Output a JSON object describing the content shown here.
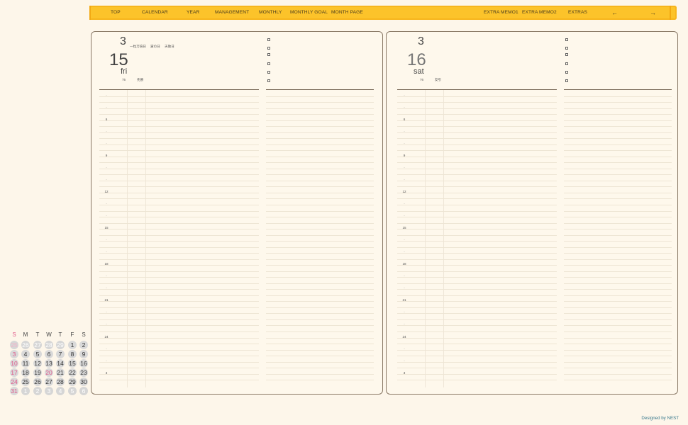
{
  "nav": {
    "items": [
      "TOP",
      "CALENDAR",
      "YEAR",
      "MANAGEMENT",
      "MONTHLY",
      "MONTHLY GOAL",
      "MONTH PAGE",
      "EXTRA MEMO1",
      "EXTRA MEMO2",
      "EXTRAS",
      "←",
      "→"
    ]
  },
  "left_page": {
    "month": "3",
    "day": "15",
    "weekday": "fri",
    "events": [
      "一粒万倍日",
      "寅の日",
      "天赦日"
    ],
    "day_count": "75",
    "rokuyo": "先勝"
  },
  "right_page": {
    "month": "3",
    "day": "16",
    "weekday": "sat",
    "day_count": "76",
    "rokuyo": "友引"
  },
  "hours": [
    "·",
    "·",
    "6",
    "·",
    "·",
    "9",
    "·",
    "·",
    "12",
    "·",
    "·",
    "15",
    "·",
    "·",
    "18",
    "·",
    "·",
    "21",
    "·",
    "·",
    "24",
    "·",
    "·",
    "3"
  ],
  "mini_calendar": {
    "headers": [
      "S",
      "M",
      "T",
      "W",
      "T",
      "F",
      "S"
    ],
    "weeks": [
      [
        "25",
        "26",
        "27",
        "28",
        "29",
        "1",
        "2"
      ],
      [
        "3",
        "4",
        "5",
        "6",
        "7",
        "8",
        "9"
      ],
      [
        "10",
        "11",
        "12",
        "13",
        "14",
        "15",
        "16"
      ],
      [
        "17",
        "18",
        "19",
        "20",
        "21",
        "22",
        "23"
      ],
      [
        "24",
        "25",
        "26",
        "27",
        "28",
        "29",
        "30"
      ],
      [
        "31",
        "1",
        "2",
        "3",
        "4",
        "5",
        "6"
      ]
    ],
    "holiday_color": "#e05a8a",
    "circle_color": "#d9d9d9"
  },
  "credit": "Designed by NEST",
  "colors": {
    "nav_bg": "#fcc32a",
    "page_border": "#8a7966",
    "background": "#fdf6ea"
  }
}
